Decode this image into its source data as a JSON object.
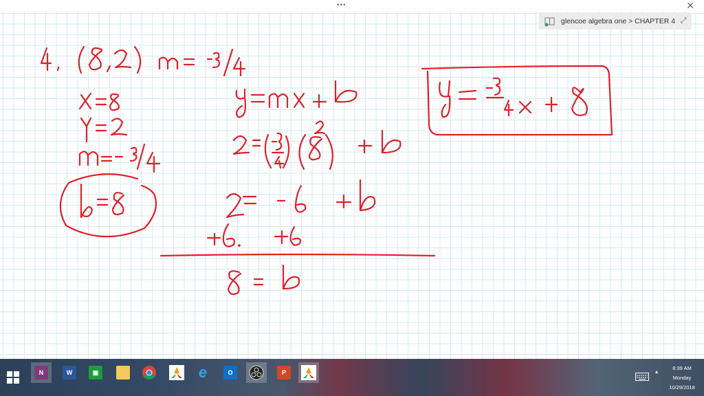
{
  "window": {
    "title_dots": "•••",
    "close_label": "✕",
    "notebook_path": "glencoe algebra one > CHAPTER 4",
    "dropdown_caret": "▼",
    "expand_label": "⤢"
  },
  "ink_color": "#e0202a",
  "note": {
    "problem": "4. (8, 2)  m = -3/4",
    "givens": [
      "x = 8",
      "y = 2",
      "m = -3/4"
    ],
    "steps": [
      "y = mx + b",
      "2 = (-3/4)(8) + b",
      "2 = -6 + b",
      "+6   +6",
      "8 = b"
    ],
    "circled_answer": "b = 8",
    "boxed_answer": "y = -3/4 x + 8"
  },
  "taskbar": {
    "apps": [
      {
        "name": "onenote",
        "label": "N",
        "color": "#80397b",
        "active": true
      },
      {
        "name": "word",
        "label": "W",
        "color": "#2b579a"
      },
      {
        "name": "store",
        "label": "🛍",
        "color": "#1a9e3a"
      },
      {
        "name": "file-explorer",
        "label": "",
        "color": "#f4c85a"
      },
      {
        "name": "chrome",
        "label": "",
        "color": "#ffffff"
      },
      {
        "name": "ms-app",
        "label": "",
        "color": "#ffffff"
      },
      {
        "name": "internet-explorer",
        "label": "e",
        "color": "#1e90d8"
      },
      {
        "name": "outlook",
        "label": "O",
        "color": "#0f6fc6"
      },
      {
        "name": "obs",
        "label": "",
        "color": "#1b1b1b",
        "active": true
      },
      {
        "name": "powerpoint",
        "label": "P",
        "color": "#d24726"
      },
      {
        "name": "ms-app-2",
        "label": "",
        "color": "#ffffff",
        "active": true
      }
    ],
    "tray": {
      "time": "8:39 AM",
      "day": "Monday",
      "date": "10/29/2018"
    }
  }
}
